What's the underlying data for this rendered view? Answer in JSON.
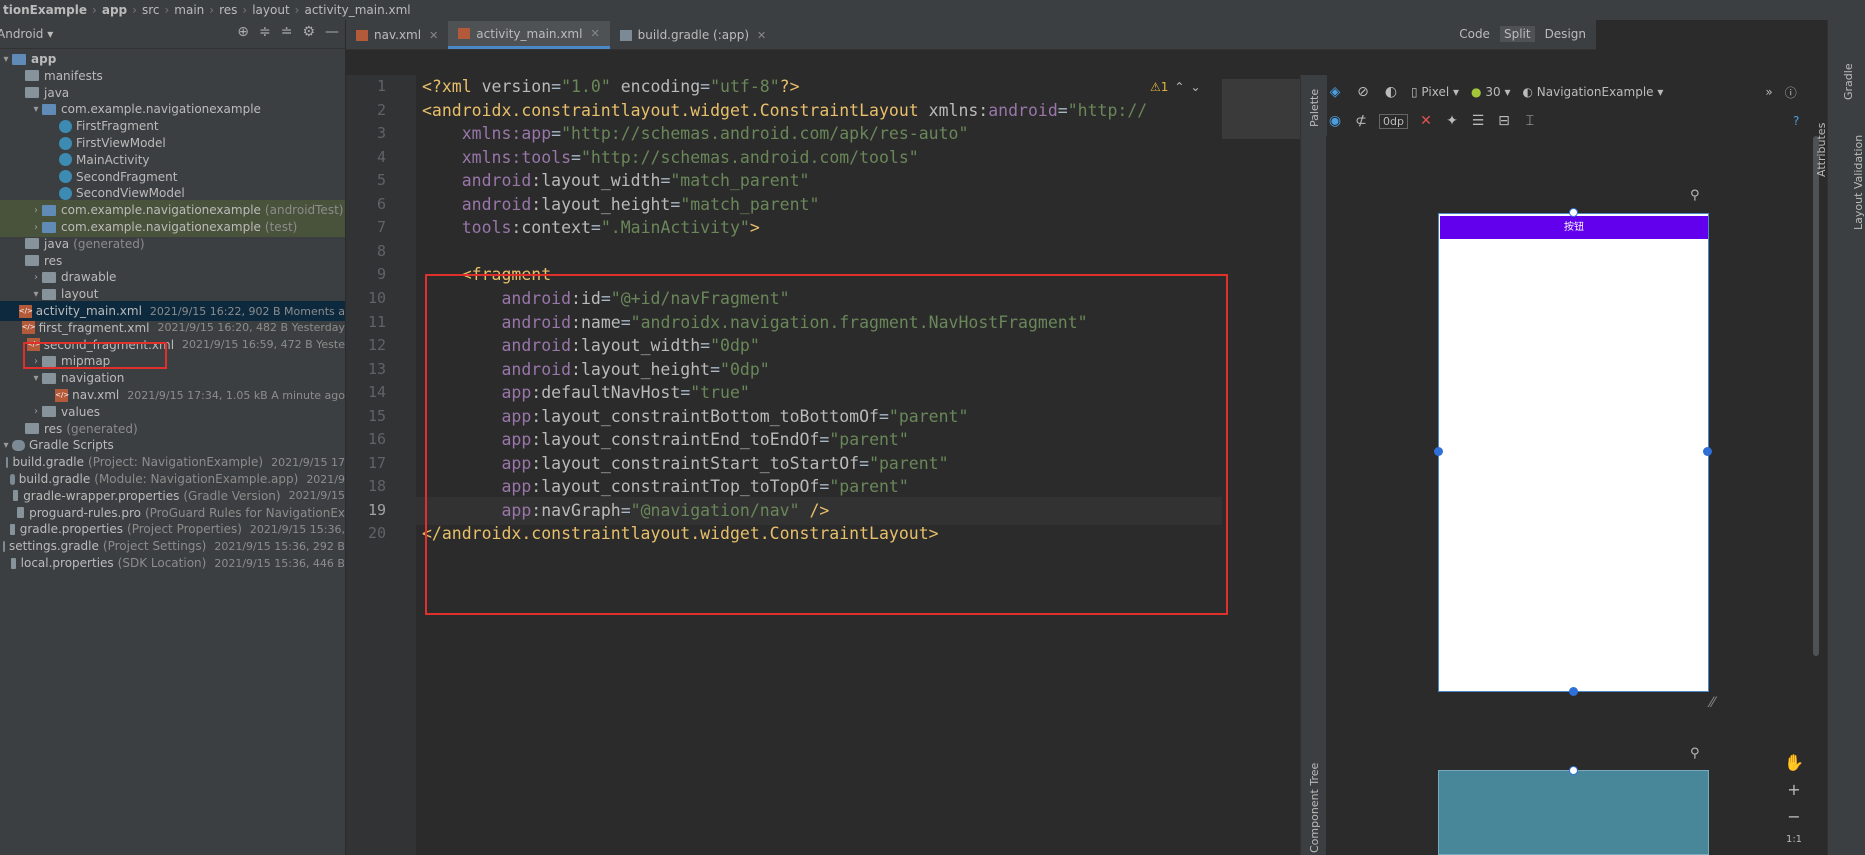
{
  "breadcrumb": [
    "tionExample",
    "app",
    "src",
    "main",
    "res",
    "layout",
    "activity_main.xml"
  ],
  "project_panel": {
    "view": "Android"
  },
  "tree": [
    {
      "label": "app",
      "indent": 0,
      "icon": "folder-module-icon",
      "arrow": "▾",
      "bold": true
    },
    {
      "label": "manifests",
      "indent": 1,
      "icon": "folder-icon",
      "arrow": ""
    },
    {
      "label": "java",
      "indent": 1,
      "icon": "folder-icon",
      "arrow": ""
    },
    {
      "label": "com.example.navigationexample",
      "indent": 2,
      "icon": "package-icon",
      "arrow": "▾"
    },
    {
      "label": "FirstFragment",
      "indent": 3,
      "icon": "class-icon",
      "arrow": ""
    },
    {
      "label": "FirstViewModel",
      "indent": 3,
      "icon": "class-icon",
      "arrow": ""
    },
    {
      "label": "MainActivity",
      "indent": 3,
      "icon": "class-icon",
      "arrow": ""
    },
    {
      "label": "SecondFragment",
      "indent": 3,
      "icon": "class-icon",
      "arrow": ""
    },
    {
      "label": "SecondViewModel",
      "indent": 3,
      "icon": "class-icon",
      "arrow": ""
    },
    {
      "label": "com.example.navigationexample",
      "paren": "(androidTest)",
      "indent": 2,
      "icon": "package-icon",
      "arrow": "›",
      "test": true
    },
    {
      "label": "com.example.navigationexample",
      "paren": "(test)",
      "indent": 2,
      "icon": "package-icon",
      "arrow": "›",
      "test": true
    },
    {
      "label": "java",
      "paren": "(generated)",
      "indent": 1,
      "icon": "folder-icon",
      "arrow": ""
    },
    {
      "label": "res",
      "indent": 1,
      "icon": "folder-icon",
      "arrow": ""
    },
    {
      "label": "drawable",
      "indent": 2,
      "icon": "folder-icon",
      "arrow": "›"
    },
    {
      "label": "layout",
      "indent": 2,
      "icon": "folder-icon",
      "arrow": "▾"
    },
    {
      "label": "activity_main.xml",
      "meta": "2021/9/15 16:22, 902 B Moments a",
      "indent": 3,
      "icon": "xml-icon",
      "arrow": "",
      "selected": true
    },
    {
      "label": "first_fragment.xml",
      "meta": "2021/9/15 16:20, 482 B Yesterday",
      "indent": 3,
      "icon": "xml-icon",
      "arrow": ""
    },
    {
      "label": "second_fragment.xml",
      "meta": "2021/9/15 16:59, 472 B Yeste",
      "indent": 3,
      "icon": "xml-icon",
      "arrow": ""
    },
    {
      "label": "mipmap",
      "indent": 2,
      "icon": "folder-icon",
      "arrow": "›"
    },
    {
      "label": "navigation",
      "indent": 2,
      "icon": "folder-icon",
      "arrow": "▾"
    },
    {
      "label": "nav.xml",
      "meta": "2021/9/15 17:34, 1.05 kB A minute ago",
      "indent": 3,
      "icon": "xml-icon",
      "arrow": ""
    },
    {
      "label": "values",
      "indent": 2,
      "icon": "folder-icon",
      "arrow": "›"
    },
    {
      "label": "res",
      "paren": "(generated)",
      "indent": 1,
      "icon": "folder-icon",
      "arrow": ""
    },
    {
      "label": "Gradle Scripts",
      "indent": 0,
      "icon": "gradle-icon",
      "arrow": "▾"
    },
    {
      "label": "build.gradle",
      "paren": "(Project: NavigationExample)",
      "meta": "2021/9/15 17",
      "indent": 1,
      "icon": "gradle-icon",
      "arrow": ""
    },
    {
      "label": "build.gradle",
      "paren": "(Module: NavigationExample.app)",
      "meta": "2021/9",
      "indent": 1,
      "icon": "gradle-icon",
      "arrow": ""
    },
    {
      "label": "gradle-wrapper.properties",
      "paren": "(Gradle Version)",
      "meta": "2021/9/15",
      "indent": 1,
      "icon": "properties-icon",
      "arrow": ""
    },
    {
      "label": "proguard-rules.pro",
      "paren": "(ProGuard Rules for NavigationEx",
      "indent": 1,
      "icon": "properties-icon",
      "arrow": ""
    },
    {
      "label": "gradle.properties",
      "paren": "(Project Properties)",
      "meta": "2021/9/15 15:36,",
      "indent": 1,
      "icon": "properties-icon",
      "arrow": ""
    },
    {
      "label": "settings.gradle",
      "paren": "(Project Settings)",
      "meta": "2021/9/15 15:36, 292 B",
      "indent": 1,
      "icon": "gradle-icon",
      "arrow": ""
    },
    {
      "label": "local.properties",
      "paren": "(SDK Location)",
      "meta": "2021/9/15 15:36, 446 B",
      "indent": 1,
      "icon": "properties-icon",
      "arrow": ""
    }
  ],
  "tabs": [
    {
      "label": "nav.xml",
      "active": false
    },
    {
      "label": "activity_main.xml",
      "active": true
    },
    {
      "label": "build.gradle (:app)",
      "active": false
    }
  ],
  "view_modes": [
    "Code",
    "Split",
    "Design"
  ],
  "editor": {
    "warnings": "⚠1",
    "lines": [
      [
        [
          "decl",
          "<?xml "
        ],
        [
          "attr",
          "version"
        ],
        [
          "pun",
          "="
        ],
        [
          "val",
          "\"1.0\""
        ],
        [
          "attr",
          " encoding"
        ],
        [
          "pun",
          "="
        ],
        [
          "val",
          "\"utf-8\""
        ],
        [
          "decl",
          "?>"
        ]
      ],
      [
        [
          "tag",
          "<androidx.constraintlayout.widget.ConstraintLayout "
        ],
        [
          "attr",
          "xmlns:"
        ],
        [
          "ns",
          "android"
        ],
        [
          "pun",
          "="
        ],
        [
          "val",
          "\"http://"
        ]
      ],
      [
        [
          "plain",
          "    "
        ],
        [
          "ns",
          "xmlns:app"
        ],
        [
          "pun",
          "="
        ],
        [
          "val",
          "\"http://schemas.android.com/apk/res-auto\""
        ]
      ],
      [
        [
          "plain",
          "    "
        ],
        [
          "ns",
          "xmlns:tools"
        ],
        [
          "pun",
          "="
        ],
        [
          "val",
          "\"http://schemas.android.com/tools\""
        ]
      ],
      [
        [
          "plain",
          "    "
        ],
        [
          "ns",
          "android"
        ],
        [
          "attr",
          ":layout_width"
        ],
        [
          "pun",
          "="
        ],
        [
          "val",
          "\"match_parent\""
        ]
      ],
      [
        [
          "plain",
          "    "
        ],
        [
          "ns",
          "android"
        ],
        [
          "attr",
          ":layout_height"
        ],
        [
          "pun",
          "="
        ],
        [
          "val",
          "\"match_parent\""
        ]
      ],
      [
        [
          "plain",
          "    "
        ],
        [
          "ns",
          "tools"
        ],
        [
          "attr",
          ":context"
        ],
        [
          "pun",
          "="
        ],
        [
          "val",
          "\".MainActivity\""
        ],
        [
          "tag",
          ">"
        ]
      ],
      [
        [
          "plain",
          ""
        ]
      ],
      [
        [
          "plain",
          "    "
        ],
        [
          "tag",
          "<fragment"
        ]
      ],
      [
        [
          "plain",
          "        "
        ],
        [
          "ns",
          "android"
        ],
        [
          "attr",
          ":id"
        ],
        [
          "pun",
          "="
        ],
        [
          "val",
          "\"@+id/navFragment\""
        ]
      ],
      [
        [
          "plain",
          "        "
        ],
        [
          "ns",
          "android"
        ],
        [
          "attr",
          ":name"
        ],
        [
          "pun",
          "="
        ],
        [
          "val",
          "\"androidx.navigation.fragment.NavHostFragment\""
        ]
      ],
      [
        [
          "plain",
          "        "
        ],
        [
          "ns",
          "android"
        ],
        [
          "attr",
          ":layout_width"
        ],
        [
          "pun",
          "="
        ],
        [
          "val",
          "\"0dp\""
        ]
      ],
      [
        [
          "plain",
          "        "
        ],
        [
          "ns",
          "android"
        ],
        [
          "attr",
          ":layout_height"
        ],
        [
          "pun",
          "="
        ],
        [
          "val",
          "\"0dp\""
        ]
      ],
      [
        [
          "plain",
          "        "
        ],
        [
          "ns",
          "app"
        ],
        [
          "attr",
          ":defaultNavHost"
        ],
        [
          "pun",
          "="
        ],
        [
          "val",
          "\"true\""
        ]
      ],
      [
        [
          "plain",
          "        "
        ],
        [
          "ns",
          "app"
        ],
        [
          "attr",
          ":layout_constraintBottom_toBottomOf"
        ],
        [
          "pun",
          "="
        ],
        [
          "val",
          "\"parent\""
        ]
      ],
      [
        [
          "plain",
          "        "
        ],
        [
          "ns",
          "app"
        ],
        [
          "attr",
          ":layout_constraintEnd_toEndOf"
        ],
        [
          "pun",
          "="
        ],
        [
          "val",
          "\"parent\""
        ]
      ],
      [
        [
          "plain",
          "        "
        ],
        [
          "ns",
          "app"
        ],
        [
          "attr",
          ":layout_constraintStart_toStartOf"
        ],
        [
          "pun",
          "="
        ],
        [
          "val",
          "\"parent\""
        ]
      ],
      [
        [
          "plain",
          "        "
        ],
        [
          "ns",
          "app"
        ],
        [
          "attr",
          ":layout_constraintTop_toTopOf"
        ],
        [
          "pun",
          "="
        ],
        [
          "val",
          "\"parent\""
        ]
      ],
      [
        [
          "plain",
          "        "
        ],
        [
          "ns",
          "app"
        ],
        [
          "attr",
          ":navGraph"
        ],
        [
          "pun",
          "="
        ],
        [
          "val",
          "\"@navigation/nav\""
        ],
        [
          "tag",
          " />"
        ]
      ],
      [
        [
          "tag",
          "</androidx.constraintlayout.widget.ConstraintLayout>"
        ]
      ]
    ],
    "current_line": 19
  },
  "design": {
    "device": "Pixel",
    "api": "30",
    "theme": "NavigationExample",
    "margin": "0dp",
    "preview_button_text": "按钮"
  },
  "side_labels": {
    "palette": "Palette",
    "component_tree": "Component Tree",
    "attributes": "Attributes",
    "gradle": "Gradle",
    "layout_validation": "Layout Validation"
  },
  "zoom": {
    "fit": "1:1"
  },
  "colors": {
    "highlight_box": "#e0302b",
    "preview_button": "#6200ee",
    "blueprint": "#48879a"
  }
}
